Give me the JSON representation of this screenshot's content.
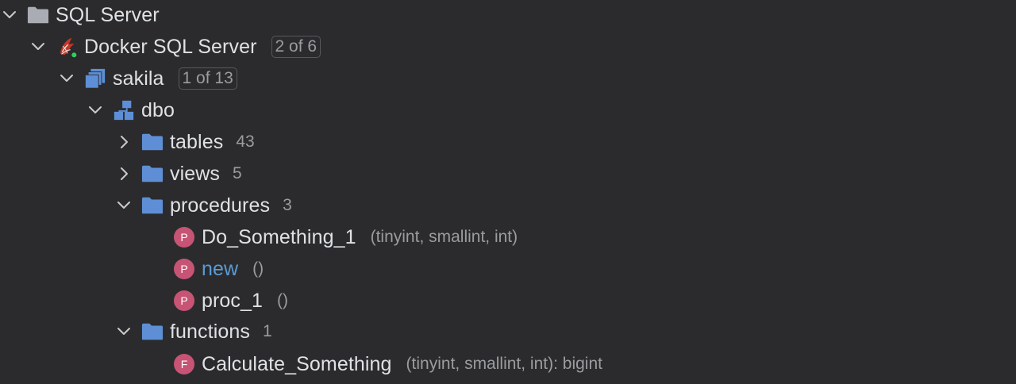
{
  "tree": {
    "root": {
      "label": "SQL Server",
      "icon": "folder-icon"
    },
    "server": {
      "label": "Docker SQL Server",
      "badge": "2 of 6",
      "icon": "sql-server-icon"
    },
    "database": {
      "label": "sakila",
      "badge": "1 of 13",
      "icon": "database-icon"
    },
    "schema": {
      "label": "dbo",
      "icon": "schema-icon"
    },
    "tables": {
      "label": "tables",
      "count": "43"
    },
    "views": {
      "label": "views",
      "count": "5"
    },
    "procedures": {
      "label": "procedures",
      "count": "3",
      "items": [
        {
          "badge": "P",
          "label": "Do_Something_1",
          "signature": "(tinyint, smallint, int)"
        },
        {
          "badge": "P",
          "label": "new",
          "signature": "()"
        },
        {
          "badge": "P",
          "label": "proc_1",
          "signature": "()"
        }
      ]
    },
    "functions": {
      "label": "functions",
      "count": "1",
      "items": [
        {
          "badge": "F",
          "label": "Calculate_Something",
          "signature": "(tinyint, smallint, int): bigint"
        }
      ]
    }
  },
  "colors": {
    "background": "#2b2b2d",
    "text": "#dfe1e5",
    "muted": "#9a9ca0",
    "folder_blue": "#5e8fd6",
    "folder_gray": "#a9acb2",
    "routine_badge": "#c75474",
    "link": "#5b9bd5"
  }
}
